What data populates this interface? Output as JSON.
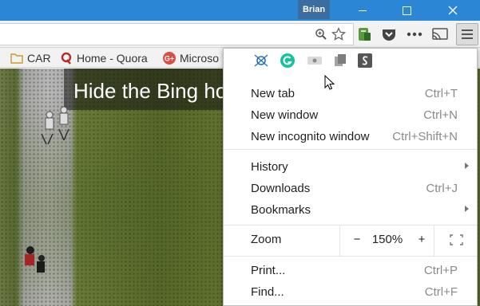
{
  "window": {
    "user": "Brian"
  },
  "toolbar": {
    "icons": [
      "zoom-icon",
      "bookmark-star-icon",
      "evernote-icon",
      "pocket-icon",
      "more-dots-icon",
      "cast-icon",
      "menu-icon"
    ]
  },
  "bookmarks": [
    {
      "label": "CAR",
      "icon": "folder-icon"
    },
    {
      "label": "Home - Quora",
      "icon": "quora-icon"
    },
    {
      "label": "Microso",
      "icon": "google-plus-icon"
    }
  ],
  "page": {
    "headline": "Hide the Bing ho"
  },
  "menu": {
    "extensions": [
      "network-icon",
      "grammarly-icon",
      "vpn-icon",
      "docs-icon",
      "scribd-icon"
    ],
    "items": [
      {
        "label": "New tab",
        "shortcut": "Ctrl+T"
      },
      {
        "label": "New window",
        "shortcut": "Ctrl+N"
      },
      {
        "label": "New incognito window",
        "shortcut": "Ctrl+Shift+N"
      },
      {
        "label": "History",
        "shortcut": ""
      },
      {
        "label": "Downloads",
        "shortcut": "Ctrl+J"
      },
      {
        "label": "Bookmarks",
        "shortcut": ""
      },
      {
        "label": "Print...",
        "shortcut": "Ctrl+P"
      },
      {
        "label": "Find...",
        "shortcut": "Ctrl+F"
      }
    ],
    "zoom": {
      "label": "Zoom",
      "minus": "−",
      "value": "150%",
      "plus": "+"
    }
  },
  "colors": {
    "titlebar": "#2b87d6",
    "user_badge": "#3c6da0",
    "grammarly": "#15c39a",
    "quora": "#b92b27"
  }
}
